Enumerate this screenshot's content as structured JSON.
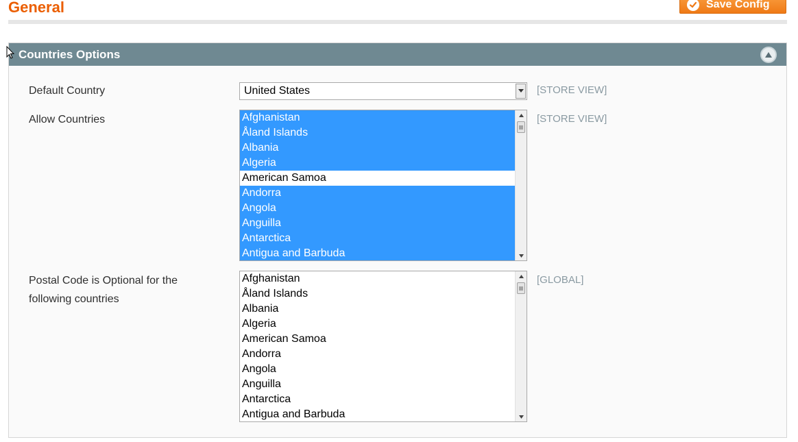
{
  "page": {
    "title": "General",
    "save_label": "Save Config"
  },
  "section": {
    "title": "Countries Options"
  },
  "fields": {
    "default_country": {
      "label": "Default Country",
      "value": "United States",
      "scope": "[STORE VIEW]"
    },
    "allow_countries": {
      "label": "Allow Countries",
      "scope": "[STORE VIEW]",
      "options": [
        {
          "label": "Afghanistan",
          "selected": true
        },
        {
          "label": "Åland Islands",
          "selected": true
        },
        {
          "label": "Albania",
          "selected": true
        },
        {
          "label": "Algeria",
          "selected": true
        },
        {
          "label": "American Samoa",
          "selected": false
        },
        {
          "label": "Andorra",
          "selected": true
        },
        {
          "label": "Angola",
          "selected": true
        },
        {
          "label": "Anguilla",
          "selected": true
        },
        {
          "label": "Antarctica",
          "selected": true
        },
        {
          "label": "Antigua and Barbuda",
          "selected": true
        }
      ]
    },
    "postal_optional": {
      "label_line1": "Postal Code is Optional for the",
      "label_line2": "following countries",
      "scope": "[GLOBAL]",
      "options": [
        {
          "label": "Afghanistan",
          "selected": false
        },
        {
          "label": "Åland Islands",
          "selected": false
        },
        {
          "label": "Albania",
          "selected": false
        },
        {
          "label": "Algeria",
          "selected": false
        },
        {
          "label": "American Samoa",
          "selected": false
        },
        {
          "label": "Andorra",
          "selected": false
        },
        {
          "label": "Angola",
          "selected": false
        },
        {
          "label": "Anguilla",
          "selected": false
        },
        {
          "label": "Antarctica",
          "selected": false
        },
        {
          "label": "Antigua and Barbuda",
          "selected": false
        }
      ]
    }
  },
  "colors": {
    "accent": "#eb5e00",
    "header_bg": "#6f8992",
    "selection": "#3399ff",
    "scope_text": "#8a9aa2"
  },
  "icons": {
    "save": "check-icon",
    "collapse": "chevron-up-icon",
    "cursor": "mouse-pointer-icon"
  }
}
